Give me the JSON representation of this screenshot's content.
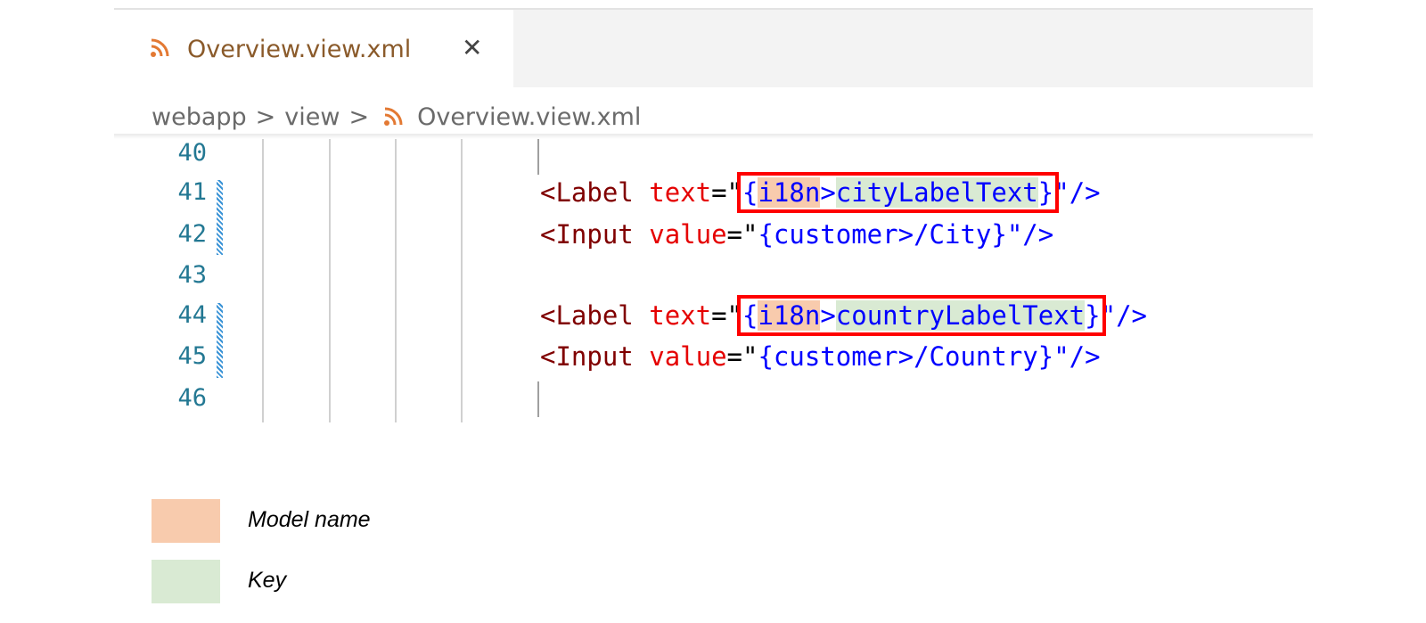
{
  "tab": {
    "label": "Overview.view.xml",
    "icon": "rss-icon",
    "close_glyph": "✕"
  },
  "breadcrumb": {
    "items": [
      "webapp",
      "view",
      "Overview.view.xml"
    ],
    "separator": ">"
  },
  "editor": {
    "line_numbers": [
      "40",
      "41",
      "42",
      "43",
      "44",
      "45",
      "46"
    ],
    "lines": {
      "l41": {
        "tag": "<Label",
        "attr": "text",
        "eq": "=\"",
        "open_brace": "{",
        "model": "i18n",
        "gt": ">",
        "key": "cityLabelText",
        "close_brace": "}",
        "end": "\"/>"
      },
      "l42": {
        "tag": "<Input",
        "attr": "value",
        "eq": "=\"",
        "binding": "{customer>/City}",
        "end": "\"/>"
      },
      "l44": {
        "tag": "<Label",
        "attr": "text",
        "eq": "=\"",
        "open_brace": "{",
        "model": "i18n",
        "gt": ">",
        "key": "countryLabelText",
        "close_brace": "}",
        "end": "\"/>"
      },
      "l45": {
        "tag": "<Input",
        "attr": "value",
        "eq": "=\"",
        "binding": "{customer>/Country}",
        "end": "\"/>"
      }
    }
  },
  "legend": {
    "items": [
      {
        "label": "Model name",
        "color": "#f8cbad"
      },
      {
        "label": "Key",
        "color": "#d9ead3"
      }
    ]
  },
  "colors": {
    "highlight_box": "#ff0000",
    "line_number": "#237893",
    "tag": "#800000",
    "attribute": "#e50000",
    "string": "#0000ff",
    "modified_gutter": "#3a93d6"
  }
}
